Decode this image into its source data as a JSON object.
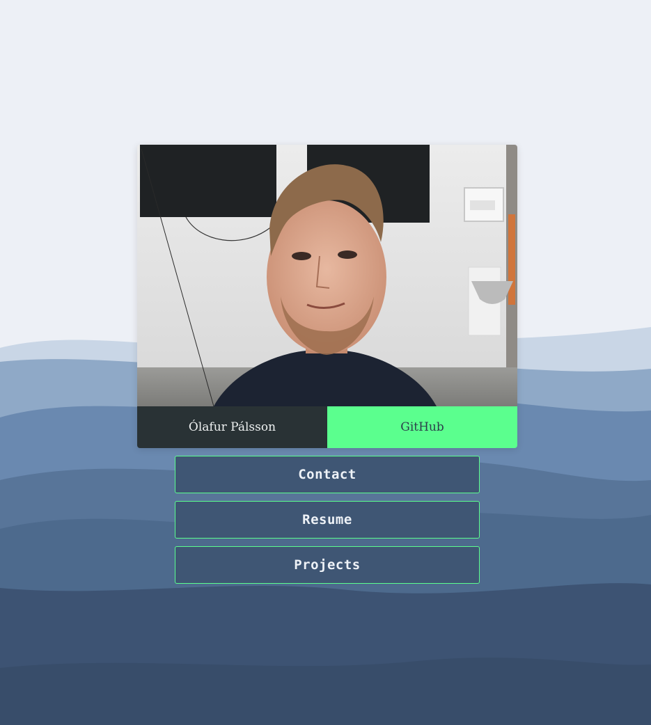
{
  "profile": {
    "name": "Ólafur Pálsson",
    "github_label": "GitHub",
    "photo_icon": "portrait-photo"
  },
  "nav": {
    "items": [
      {
        "label": "Contact"
      },
      {
        "label": "Resume"
      },
      {
        "label": "Projects"
      }
    ]
  },
  "colors": {
    "accent": "#5bff8e",
    "card_dark": "#293235",
    "button_bg": "#3f5674",
    "page_top": "#edf0f6",
    "page_bottom": "#3b4f6a"
  }
}
